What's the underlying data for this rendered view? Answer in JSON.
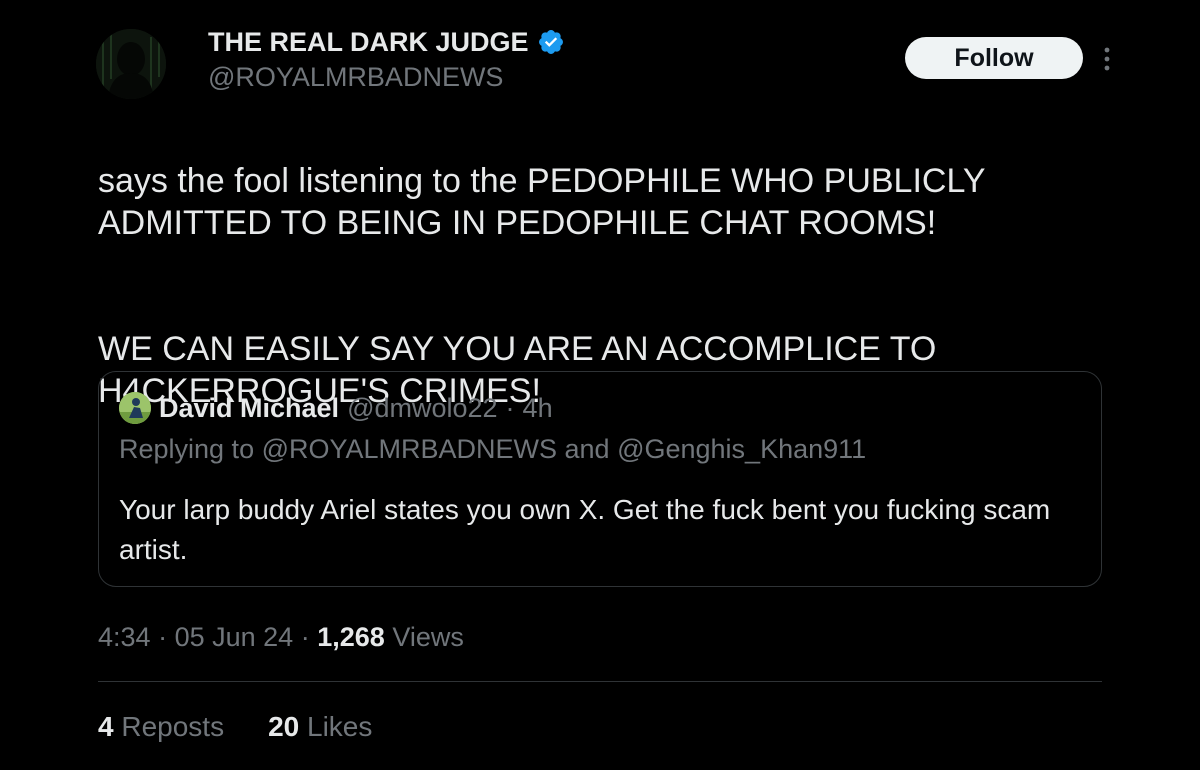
{
  "author": {
    "display_name": "THE REAL DARK JUDGE",
    "handle": "@ROYALMRBADNEWS",
    "verified": true,
    "avatar_icon": "hooded-figure-avatar"
  },
  "follow_button": {
    "label": "Follow"
  },
  "more_menu_icon": "vertical-ellipsis-icon",
  "tweet": {
    "paragraphs": [
      "says the fool listening to the PEDOPHILE WHO PUBLICLY ADMITTED TO BEING IN PEDOPHILE CHAT ROOMS!",
      "WE CAN EASILY SAY YOU ARE AN ACCOMPLICE TO H4CKERROGUE'S CRIMES!"
    ]
  },
  "quoted_tweet": {
    "display_name": "David Michael",
    "handle": "@dmwolo22",
    "separator": "·",
    "time": "4h",
    "replying_to": "Replying to @ROYALMRBADNEWS and @Genghis_Khan911",
    "text": "Your larp buddy Ariel states you own X. Get the fuck bent you fucking scam artist."
  },
  "meta": {
    "time": "4:34",
    "date": "05 Jun 24",
    "separator": "·",
    "views_count": "1,268",
    "views_label": "Views"
  },
  "stats": {
    "reposts_count": "4",
    "reposts_label": "Reposts",
    "likes_count": "20",
    "likes_label": "Likes"
  },
  "colors": {
    "background": "#000000",
    "primary_text": "#e7e9ea",
    "secondary_text": "#71767b",
    "verified_badge": "#1d9bf0",
    "border": "#2f3336"
  }
}
